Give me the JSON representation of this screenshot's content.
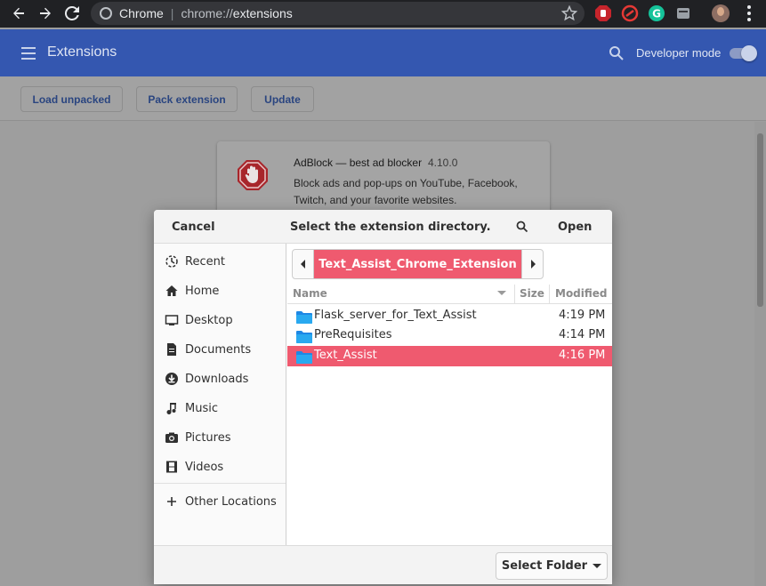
{
  "browser": {
    "site_chip": "Chrome",
    "url_scheme": "chrome://",
    "url_path": "extensions"
  },
  "ext_page": {
    "title": "Extensions",
    "developer_mode_label": "Developer mode",
    "developer_mode_on": true,
    "toolbar": {
      "load_unpacked": "Load unpacked",
      "pack_extension": "Pack extension",
      "update": "Update"
    },
    "card": {
      "name": "AdBlock — best ad blocker",
      "version": "4.10.0",
      "description": "Block ads and pop-ups on YouTube, Facebook, Twitch, and your favorite websites."
    }
  },
  "dialog": {
    "cancel_label": "Cancel",
    "title": "Select the extension directory.",
    "open_label": "Open",
    "places": [
      {
        "label": "Recent",
        "icon": "recent-icon"
      },
      {
        "label": "Home",
        "icon": "home-icon"
      },
      {
        "label": "Desktop",
        "icon": "desktop-icon"
      },
      {
        "label": "Documents",
        "icon": "documents-icon"
      },
      {
        "label": "Downloads",
        "icon": "downloads-icon"
      },
      {
        "label": "Music",
        "icon": "music-icon"
      },
      {
        "label": "Pictures",
        "icon": "pictures-icon"
      },
      {
        "label": "Videos",
        "icon": "videos-icon"
      }
    ],
    "other_locations": "Other Locations",
    "path_current": "Text_Assist_Chrome_Extension",
    "columns": {
      "name": "Name",
      "size": "Size",
      "modified": "Modified"
    },
    "files": [
      {
        "name": "Flask_server_for_Text_Assist",
        "size": "",
        "modified": "4:19 PM",
        "selected": false
      },
      {
        "name": "PreRequisites",
        "size": "",
        "modified": "4:14 PM",
        "selected": false
      },
      {
        "name": "Text_Assist",
        "size": "",
        "modified": "4:16 PM",
        "selected": true
      }
    ],
    "select_folder_label": "Select Folder"
  },
  "colors": {
    "accent_selection": "#ef5a6f",
    "header_blue": "#3457b0",
    "browser_dark": "#202124"
  }
}
